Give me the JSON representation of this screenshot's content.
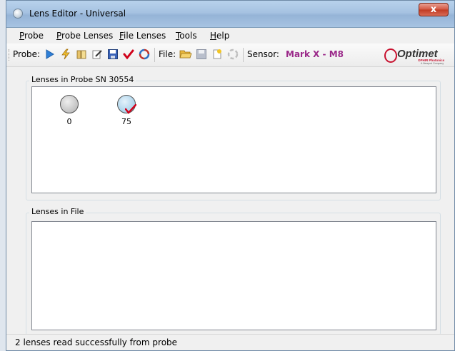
{
  "window": {
    "title": "Lens Editor - Universal",
    "close_symbol": "x"
  },
  "menu": {
    "probe": {
      "accel": "P",
      "rest": "robe"
    },
    "probe_lenses": {
      "accel": "P",
      "rest": "robe Lenses"
    },
    "file_lenses": {
      "accel": "F",
      "rest": "ile Lenses"
    },
    "tools": {
      "accel": "T",
      "rest": "ools"
    },
    "help": {
      "accel": "H",
      "rest": "elp"
    }
  },
  "toolbar": {
    "probe_label": "Probe:",
    "file_label": "File:",
    "sensor_label": "Sensor:",
    "sensor_value": "Mark X - M8",
    "icons": [
      "play-icon",
      "lightning-icon",
      "book-icon",
      "edit-icon",
      "save-icon",
      "checkmark-icon",
      "swirl-icon",
      "folder-open-icon",
      "save-disabled-icon",
      "new-file-icon",
      "swirl-disabled-icon"
    ]
  },
  "logo": {
    "name": "Optimet",
    "sub1": "OPHIR Photonics",
    "sub2": "A Newport Company"
  },
  "probe_group": {
    "label": "Lenses in Probe SN 30554",
    "lenses": [
      {
        "number": "0",
        "state": "normal"
      },
      {
        "number": "75",
        "state": "selected-checked"
      }
    ]
  },
  "file_group": {
    "label": "Lenses in File",
    "lenses": []
  },
  "status": {
    "text": "2 lenses read successfully from probe"
  },
  "colors": {
    "sensor_value": "#9b2a8a",
    "check": "#d0021b",
    "titlebar": "#a6c2e1"
  }
}
